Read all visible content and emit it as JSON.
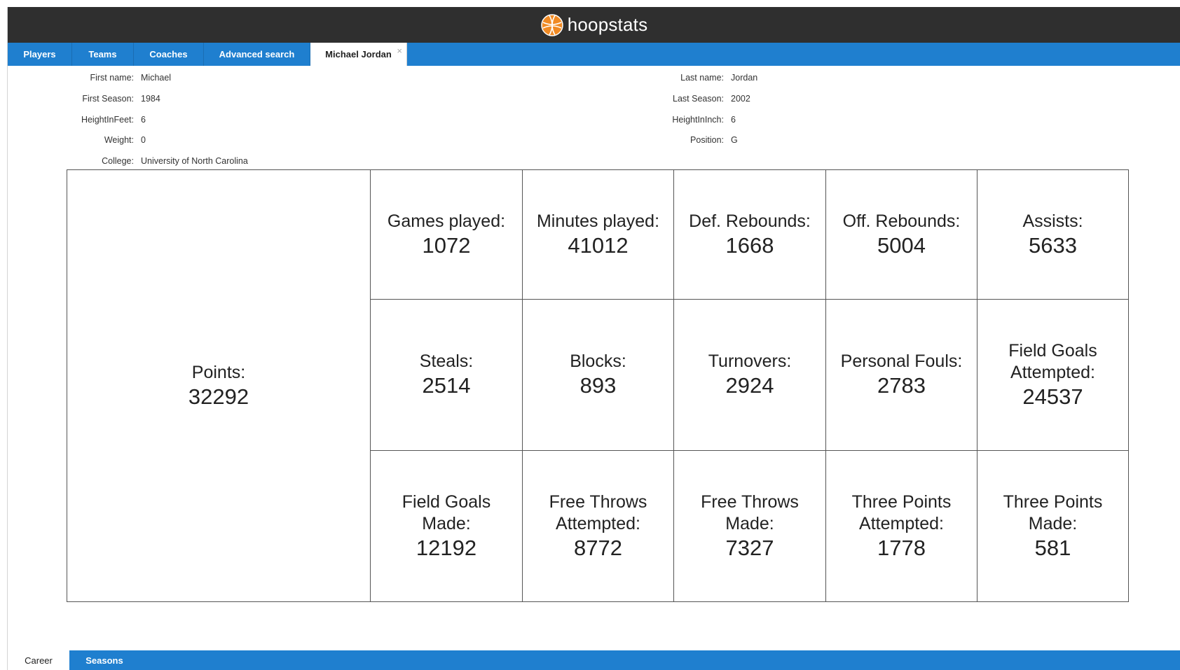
{
  "app": {
    "brand": "hoopstats",
    "logo_icon": "basketball-icon",
    "accent": "#1f7fcf",
    "header_bg": "#2f2f2f"
  },
  "tabs": [
    {
      "label": "Players"
    },
    {
      "label": "Teams"
    },
    {
      "label": "Coaches"
    },
    {
      "label": "Advanced search"
    },
    {
      "label": "Michael Jordan",
      "active": true,
      "close": "×"
    }
  ],
  "player": {
    "left": [
      {
        "label": "First name:",
        "value": "Michael"
      },
      {
        "label": "First Season:",
        "value": "1984"
      },
      {
        "label": "HeightInFeet:",
        "value": "6"
      },
      {
        "label": "Weight:",
        "value": "0"
      },
      {
        "label": "College:",
        "value": "University of North Carolina"
      }
    ],
    "right": [
      {
        "label": "Last name:",
        "value": "Jordan"
      },
      {
        "label": "Last Season:",
        "value": "2002"
      },
      {
        "label": "HeightInInch:",
        "value": "6"
      },
      {
        "label": "Position:",
        "value": "G"
      }
    ]
  },
  "stats": {
    "points": {
      "label": "Points:",
      "value": "32292"
    },
    "grid": [
      {
        "label": "Games played:",
        "value": "1072"
      },
      {
        "label": "Minutes played:",
        "value": "41012"
      },
      {
        "label": "Def. Rebounds:",
        "value": "1668"
      },
      {
        "label": "Off. Rebounds:",
        "value": "5004"
      },
      {
        "label": "Assists:",
        "value": "5633"
      },
      {
        "label": "Steals:",
        "value": "2514"
      },
      {
        "label": "Blocks:",
        "value": "893"
      },
      {
        "label": "Turnovers:",
        "value": "2924"
      },
      {
        "label": "Personal Fouls:",
        "value": "2783"
      },
      {
        "label": "Field Goals Attempted:",
        "value": "24537"
      },
      {
        "label": "Field Goals Made:",
        "value": "12192"
      },
      {
        "label": "Free Throws Attempted:",
        "value": "8772"
      },
      {
        "label": "Free Throws Made:",
        "value": "7327"
      },
      {
        "label": "Three Points Attempted:",
        "value": "1778"
      },
      {
        "label": "Three Points Made:",
        "value": "581"
      }
    ]
  },
  "bottom_tabs": [
    {
      "label": "Career",
      "active": true
    },
    {
      "label": "Seasons"
    }
  ]
}
